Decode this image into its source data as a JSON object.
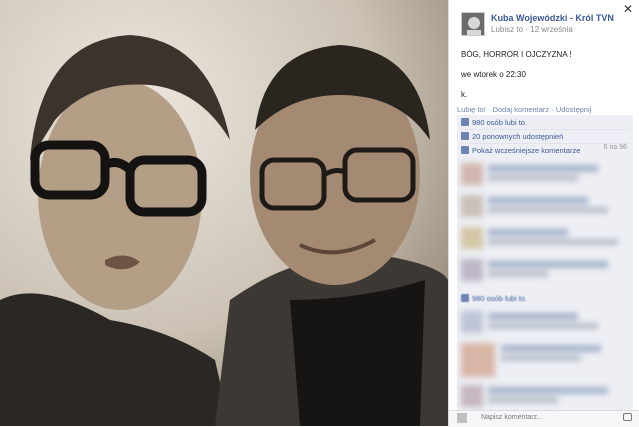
{
  "photo": {
    "alt": ""
  },
  "sidebar": {
    "close_label": "✕",
    "author": "Kuba Wojewódzki - Król TVN",
    "meta": "Lubisz to · 12 września",
    "post_lines": [
      "BÓG, HORROR I OJCZYZNA !",
      "we wtorek o 22:30",
      "k."
    ],
    "actions": {
      "like": "Lubię to!",
      "comment": "Dodaj komentarz",
      "share": "Udostępnij",
      "separator": "·"
    },
    "likes": "980 osób lubi to.",
    "shares": "20 ponownych udostępnień",
    "older_comments": "Pokaż wcześniejsze komentarze",
    "older_count": "6 na 96",
    "likes_bottom": "980 osób lubi to.",
    "comment_placeholder": "Napisz komentarz..."
  },
  "colors": {
    "link": "#3b5998",
    "panel": "#edeff4"
  }
}
